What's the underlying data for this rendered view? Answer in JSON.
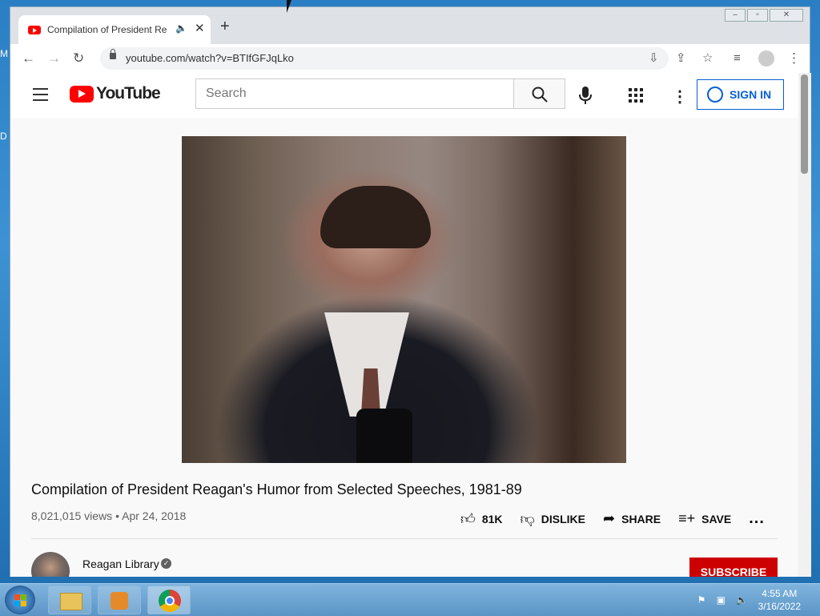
{
  "desktop": {
    "edge_letters": [
      "M",
      "D"
    ]
  },
  "browser": {
    "tab": {
      "title": "Compilation of President Rea",
      "audio_icon": "speaker-icon",
      "close": "✕"
    },
    "new_tab": "+",
    "url": "youtube.com/watch?v=BTIfGFJqLko"
  },
  "youtube": {
    "logo_text": "YouTube",
    "search_placeholder": "Search",
    "sign_in": "SIGN IN",
    "video": {
      "title": "Compilation of President Reagan's Humor from Selected Speeches, 1981-89",
      "views": "8,021,015 views",
      "date": "Apr 24, 2018",
      "likes": "81K",
      "dislike_label": "DISLIKE",
      "share_label": "SHARE",
      "save_label": "SAVE",
      "more": "..."
    },
    "channel": {
      "name": "Reagan Library",
      "subscribe": "SUBSCRIBE"
    }
  },
  "taskbar": {
    "time": "4:55 AM",
    "date": "3/16/2022",
    "apps": [
      "file-explorer",
      "media-player",
      "chrome"
    ]
  },
  "colors": {
    "youtube_red": "#ff0000",
    "link_blue": "#065fd4",
    "subscribe_red": "#cc0000"
  }
}
